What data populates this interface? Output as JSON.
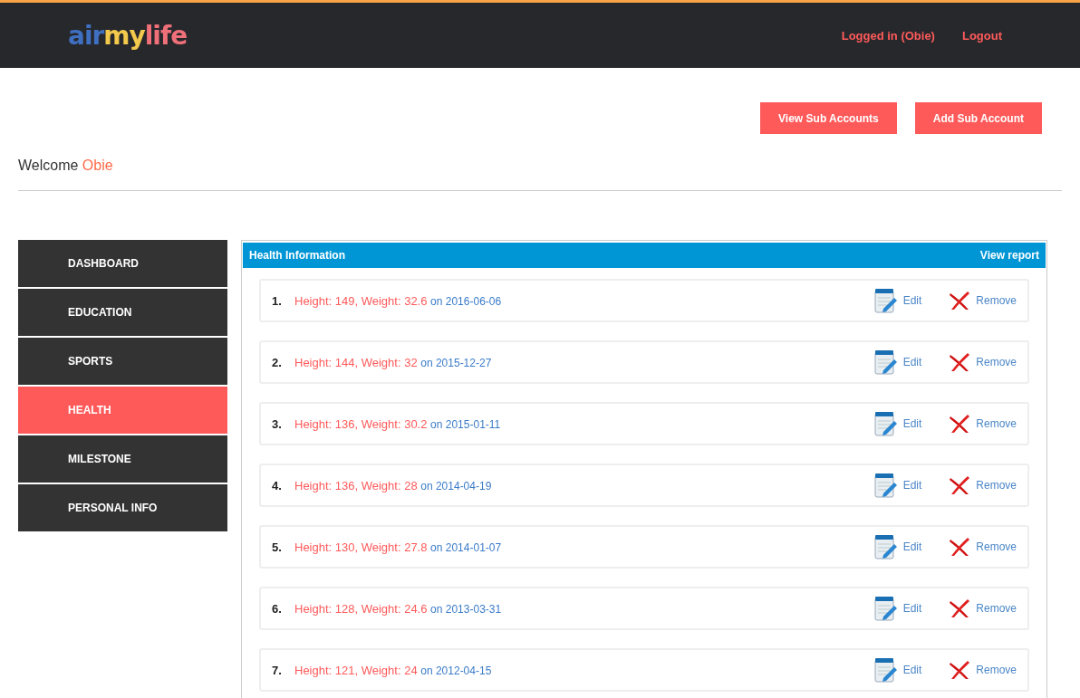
{
  "header": {
    "logo": [
      {
        "text": "air",
        "color": "#3f6fc0"
      },
      {
        "text": "my",
        "color": "#f2c94c"
      },
      {
        "text": "life",
        "color": "#f0707a"
      }
    ],
    "links": [
      "Logged in (Obie)",
      "Logout"
    ]
  },
  "actions": [
    "View Sub Accounts",
    "Add Sub Account"
  ],
  "welcome": {
    "label": "Welcome",
    "name": "Obie"
  },
  "sidebar": {
    "items": [
      {
        "label": "DASHBOARD",
        "selected": false
      },
      {
        "label": "EDUCATION",
        "selected": false
      },
      {
        "label": "SPORTS",
        "selected": false
      },
      {
        "label": "HEALTH",
        "selected": true
      },
      {
        "label": "MILESTONE",
        "selected": false
      },
      {
        "label": "PERSONAL INFO",
        "selected": false
      }
    ]
  },
  "panel": {
    "title": "Health Information",
    "link": "View report",
    "records": [
      {
        "number": "1.",
        "measurement": "Height: 149, Weight: 32.6",
        "date": "on 2016-06-06",
        "edit": "Edit",
        "remove": "Remove"
      },
      {
        "number": "2.",
        "measurement": "Height: 144, Weight: 32",
        "date": "on 2015-12-27",
        "edit": "Edit",
        "remove": "Remove"
      },
      {
        "number": "3.",
        "measurement": "Height: 136, Weight: 30.2",
        "date": "on 2015-01-11",
        "edit": "Edit",
        "remove": "Remove"
      },
      {
        "number": "4.",
        "measurement": "Height: 136, Weight: 28",
        "date": "on 2014-04-19",
        "edit": "Edit",
        "remove": "Remove"
      },
      {
        "number": "5.",
        "measurement": "Height: 130, Weight: 27.8",
        "date": "on 2014-01-07",
        "edit": "Edit",
        "remove": "Remove"
      },
      {
        "number": "6.",
        "measurement": "Height: 128, Weight: 24.6",
        "date": "on 2013-03-31",
        "edit": "Edit",
        "remove": "Remove"
      },
      {
        "number": "7.",
        "measurement": "Height: 121, Weight: 24",
        "date": "on 2012-04-15",
        "edit": "Edit",
        "remove": "Remove"
      }
    ]
  }
}
